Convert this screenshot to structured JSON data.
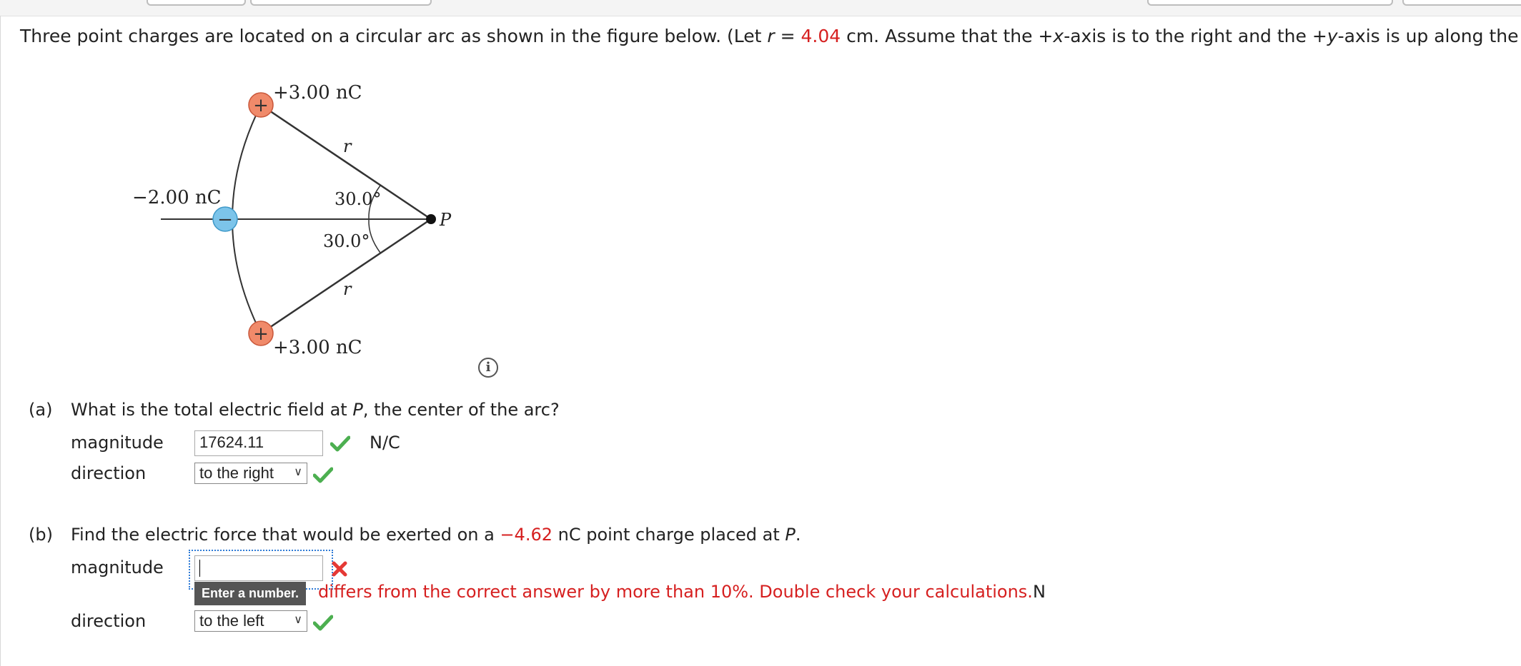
{
  "question": {
    "intro_before_r": "Three point charges are located on a circular arc as shown in the figure below. (Let ",
    "r_symbol": "r",
    "equals": " = ",
    "r_value": "4.04",
    "intro_after_r": " cm. Assume that the +",
    "x_axis": "x",
    "intro_mid": "-axis is to the right and the +",
    "y_axis": "y",
    "intro_end": "-axis is up along the page.)"
  },
  "figure": {
    "top_charge_label": "+3.00 nC",
    "left_charge_label": "−2.00 nC",
    "bottom_charge_label": "+3.00 nC",
    "angle_top": "30.0°",
    "angle_bottom": "30.0°",
    "r_top": "r",
    "r_bottom": "r",
    "point_label": "P",
    "plus_sign": "+",
    "minus_sign": "−",
    "positive_color": "#f08a6a",
    "negative_color": "#7cc4ea"
  },
  "info_icon": {
    "glyph": "i"
  },
  "part_a": {
    "label": "(a)",
    "text_before": "What is the total electric field at ",
    "p_symbol": "P",
    "text_after": ", the center of the arc?",
    "magnitude_label": "magnitude",
    "magnitude_value": "17624.11",
    "unit": "N/C",
    "direction_label": "direction",
    "direction_value": "to the right"
  },
  "part_b": {
    "label": "(b)",
    "text_before": "Find the electric force that would be exerted on a ",
    "charge_value": "−4.62",
    "text_mid": " nC point charge placed at ",
    "p_symbol": "P",
    "text_after": ".",
    "magnitude_label": "magnitude",
    "magnitude_value": "",
    "tooltip": "Enter a number.",
    "feedback": "differs from the correct answer by more than 10%. Double check your calculations.",
    "unit": "N",
    "direction_label": "direction",
    "direction_value": "to the left"
  },
  "colors": {
    "accent_red": "#d62020",
    "check_green": "#4caf50",
    "cross_red": "#e53935"
  }
}
